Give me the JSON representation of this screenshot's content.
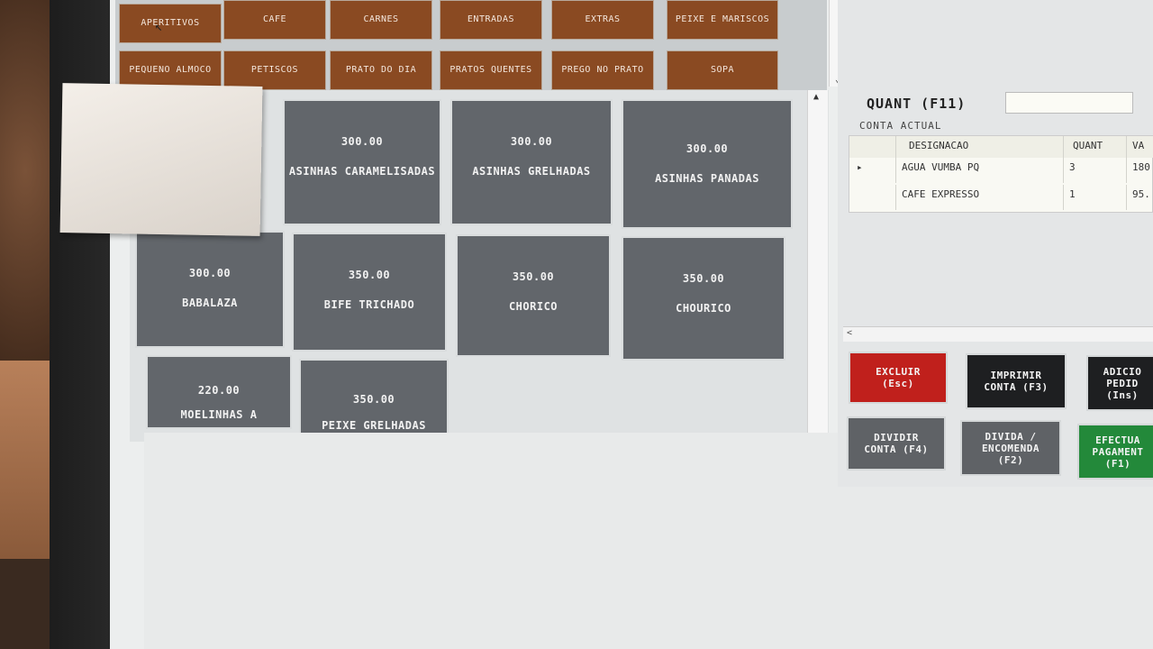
{
  "categories": [
    {
      "label": "APERITIVOS"
    },
    {
      "label": "CAFE"
    },
    {
      "label": "CARNES"
    },
    {
      "label": "ENTRADAS"
    },
    {
      "label": "EXTRAS"
    },
    {
      "label": "PEIXE E MARISCOS"
    },
    {
      "label": "PEQUENO ALMOCO"
    },
    {
      "label": "PETISCOS"
    },
    {
      "label": "PRATO DO DIA"
    },
    {
      "label": "PRATOS QUENTES"
    },
    {
      "label": "PREGO NO PRATO"
    },
    {
      "label": "SOPA"
    }
  ],
  "products": [
    {
      "price": "300.00",
      "name": "ASINHAS CARAMELISADAS"
    },
    {
      "price": "300.00",
      "name": "ASINHAS GRELHADAS"
    },
    {
      "price": "300.00",
      "name": "ASINHAS PANADAS"
    },
    {
      "price": "300.00",
      "name": "BABALAZA"
    },
    {
      "price": "350.00",
      "name": "BIFE TRICHADO"
    },
    {
      "price": "350.00",
      "name": "CHORICO"
    },
    {
      "price": "350.00",
      "name": "CHOURICO"
    },
    {
      "price": "220.00",
      "name": "MOELINHAS A"
    },
    {
      "price": "350.00",
      "name": "PEIXE GRELHADAS"
    }
  ],
  "quant": {
    "label": "QUANT (F11)",
    "value": ""
  },
  "account": {
    "label": "CONTA ACTUAL",
    "headers": [
      "DESIGNACAO",
      "QUANT",
      "VA"
    ],
    "rows": [
      {
        "selector": "▸",
        "name": "AGUA VUMBA PQ",
        "quant": "3",
        "value": "180"
      },
      {
        "selector": "",
        "name": "CAFE EXPRESSO",
        "quant": "1",
        "value": "95."
      }
    ]
  },
  "actions": {
    "excluir": "EXCLUIR\n(Esc)",
    "imprimir": "IMPRIMIR\nCONTA (F3)",
    "adicionar": "ADICIO\nPEDID\n(Ins)",
    "dividir": "DIVIDIR\nCONTA (F4)",
    "divida": "DIVIDA /\nENCOMENDA\n(F2)",
    "efectuar": "EFECTUA\nPAGAMENT\n(F1)"
  },
  "icons": {
    "scroll_up": "▲",
    "scroll_down": "⌄",
    "scroll_left": "<"
  },
  "colors": {
    "category": "#8a4a22",
    "product": "#62666b",
    "excluir": "#c0201c",
    "efectuar": "#23893a",
    "dark_action": "#1e1f21",
    "grey_action": "#5f6266"
  }
}
